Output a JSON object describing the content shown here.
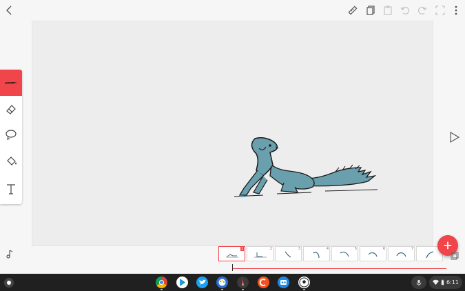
{
  "toolbar": {
    "back_icon": "chevron-left-icon",
    "icons": [
      "ruler-icon",
      "copy-icon",
      "paste-icon",
      "undo-icon",
      "redo-icon",
      "fullscreen-icon",
      "more-vert-icon"
    ]
  },
  "tools": [
    "brush-icon",
    "eraser-icon",
    "lasso-icon",
    "fill-bucket-icon",
    "text-icon"
  ],
  "active_tool": "brush-icon",
  "timeline": {
    "frames": [
      {
        "number": "1",
        "selected": true
      },
      {
        "number": "2",
        "selected": false
      },
      {
        "number": "3",
        "selected": false
      },
      {
        "number": "4",
        "selected": false
      },
      {
        "number": "5",
        "selected": false
      },
      {
        "number": "6",
        "selected": false
      },
      {
        "number": "7",
        "selected": false
      },
      {
        "number": "8",
        "selected": false
      }
    ]
  },
  "shelf": {
    "apps": [
      "chrome-icon",
      "play-store-icon",
      "twitter-icon",
      "palette-icon",
      "pencil-app-icon",
      "cast-app-icon",
      "paint-app-icon",
      "soccer-app-icon"
    ],
    "time": "6:11"
  },
  "colors": {
    "accent": "#f0454a",
    "squirrel_fill": "#6a9fae",
    "taskbar": "#202020"
  }
}
